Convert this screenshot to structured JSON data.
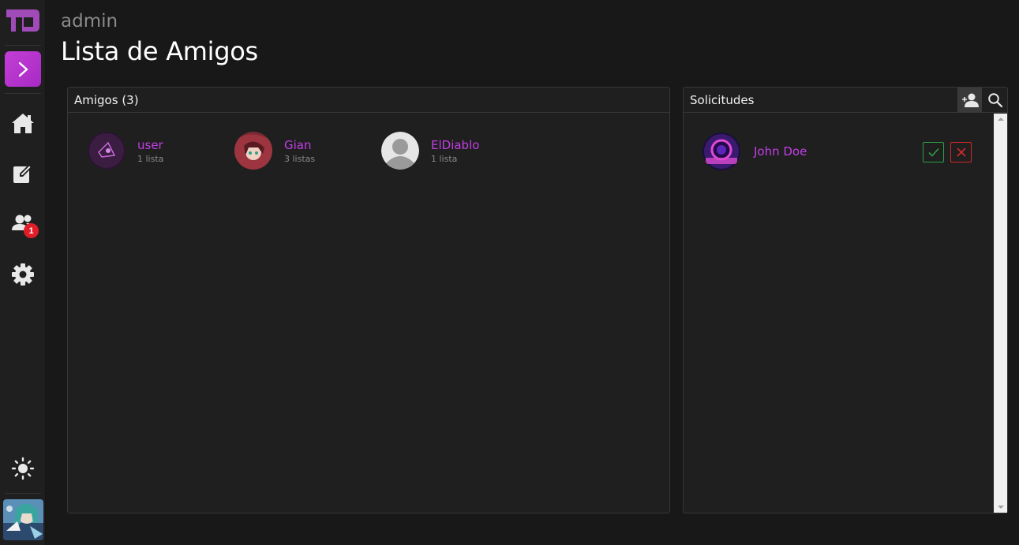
{
  "header": {
    "username": "admin",
    "title": "Lista de Amigos"
  },
  "sidebar": {
    "nav": [
      {
        "name": "home",
        "icon": "home-icon"
      },
      {
        "name": "edit",
        "icon": "edit-icon"
      },
      {
        "name": "friends",
        "icon": "users-icon",
        "badge": "1"
      },
      {
        "name": "settings",
        "icon": "gear-icon"
      }
    ],
    "theme_icon": "sun-icon",
    "accent": "#c23fd6"
  },
  "friends_panel": {
    "title": "Amigos (3)",
    "friends": [
      {
        "name": "user",
        "meta": "1 lista"
      },
      {
        "name": "Gian",
        "meta": "3 listas"
      },
      {
        "name": "ElDiablo",
        "meta": "1 lista"
      }
    ]
  },
  "requests_panel": {
    "title": "Solicitudes",
    "requests": [
      {
        "name": "John Doe"
      }
    ]
  },
  "colors": {
    "background": "#181818",
    "panel": "#1f1f1f",
    "name": "#c23fe6",
    "accept": "#2ea043",
    "reject": "#d42a2a",
    "badge": "#e11d2a"
  }
}
